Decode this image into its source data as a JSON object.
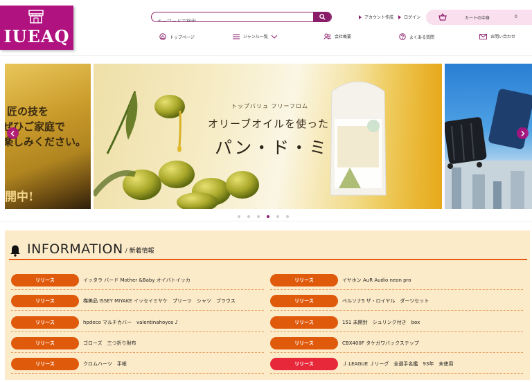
{
  "header": {
    "logo_text": "IUEAQ",
    "search_placeholder": "キーワードで検索",
    "links": [
      "アカウント作成",
      "ログイン"
    ],
    "cart_label": "カートの中身",
    "cart_count": "0"
  },
  "nav": [
    {
      "label": "トップページ",
      "icon": "home-icon"
    },
    {
      "label": "ジャンル一覧",
      "icon": "menu-icon"
    },
    {
      "label": "会社概要",
      "icon": "people-icon"
    },
    {
      "label": "よくある質問",
      "icon": "question-icon"
    },
    {
      "label": "お問い合わせ",
      "icon": "mail-icon"
    }
  ],
  "carousel": {
    "left_slide_lines": [
      "匠の技を",
      "ぜひご家庭で",
      "楽しみください。"
    ],
    "left_slide_bottom": "開中!",
    "main_sub": "トップバリュ フリーフロム",
    "main_headline": "オリーブオイルを使った",
    "main_product": "パン・ド・ミ",
    "dot_count": 6,
    "active_dot": 3
  },
  "information": {
    "title": "INFORMATION",
    "subtitle": "/ 新着情報",
    "items_left": [
      {
        "badge": "リリース",
        "text": "イッタラ バード Mother &Baby オイバトイッカ"
      },
      {
        "badge": "リリース",
        "text": "梯美品 ISSEY MIYAKE イッセイミヤケ　プリーツ　シャツ　ブラウス"
      },
      {
        "badge": "リリース",
        "text": "hpdeco マルチカバー　valentinahoyos ♪"
      },
      {
        "badge": "リリース",
        "text": "ゴローズ　三つ折り財布"
      },
      {
        "badge": "リリース",
        "text": "クロムハーツ　手帳"
      }
    ],
    "items_right": [
      {
        "badge": "リリース",
        "text": "イヤホン AuR Audio neon pro"
      },
      {
        "badge": "リリース",
        "text": "ペルソナ5 ザ・ロイヤル　ダーツセット"
      },
      {
        "badge": "リリース",
        "text": "151 未開封　シュリンク付き　box"
      },
      {
        "badge": "リリース",
        "text": "CBX400F タケガワバックステップ"
      },
      {
        "badge": "リリース",
        "text": "Ｊ.LEAGUE Ｊリーグ　全選手名鑑　93年　未使用"
      }
    ]
  },
  "colors": {
    "brand": "#b0127f",
    "accent_orange": "#e05a0c",
    "accent_red": "#e7283a",
    "info_bg": "#fcebc9"
  }
}
